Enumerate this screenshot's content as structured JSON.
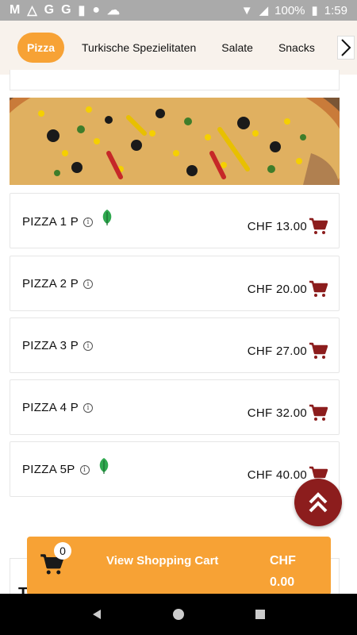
{
  "status_bar": {
    "left_icons": [
      "gmail-icon",
      "drive-icon",
      "google-icon",
      "google-icon",
      "sd-card-icon",
      "circle-icon",
      "cloud-icon"
    ],
    "battery": "100%",
    "time": "1:59"
  },
  "tabs": {
    "items": [
      "Pizza",
      "Turkische Spezielitaten",
      "Salate",
      "Snacks"
    ],
    "active": "Pizza"
  },
  "menu_items": [
    {
      "name": "PIZZA 1 P",
      "price": "CHF 13.00",
      "vegetarian": true
    },
    {
      "name": "PIZZA 2 P",
      "price": "CHF 20.00",
      "vegetarian": false
    },
    {
      "name": "PIZZA 3 P",
      "price": "CHF 27.00",
      "vegetarian": false
    },
    {
      "name": "PIZZA 4 P",
      "price": "CHF 32.00",
      "vegetarian": false
    },
    {
      "name": "PIZZA 5P",
      "price": "CHF 40.00",
      "vegetarian": true
    }
  ],
  "partial_text": "T",
  "cart": {
    "count": "0",
    "label": "View Shopping Cart",
    "currency": "CHF",
    "total": "0.00"
  },
  "colors": {
    "accent": "#f7a235",
    "brand_dark": "#8c1d1d",
    "cart_icon": "#8c1d1d",
    "leaf": "#2fa84f"
  }
}
